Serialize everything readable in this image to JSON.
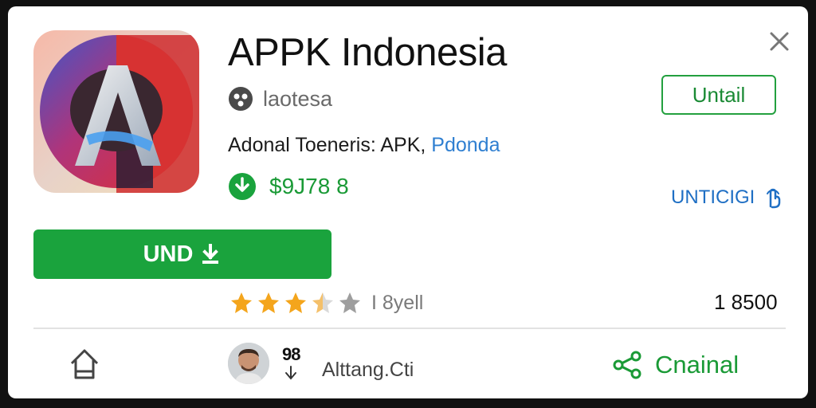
{
  "app": {
    "title": "APPK Indonesia",
    "developer": "laotesa",
    "description_main": "Adonal Toeneris: APK,",
    "description_link": "Pdonda",
    "downloads": "$9J78 8"
  },
  "actions": {
    "outline_button_label": "Untail",
    "side_link_label": "UNTICIGI",
    "install_button_label": "UND"
  },
  "rating": {
    "stars": 3.5,
    "max_stars": 5,
    "label": "I 8yell",
    "count": "1 8500"
  },
  "footer": {
    "user_number": "98",
    "user_name": "Alttang.Cti",
    "share_label": "Cnainal"
  },
  "colors": {
    "accent_green": "#1aa33d",
    "link_blue": "#2f7fd1",
    "star_gold": "#f4a51c",
    "star_grey": "#9e9e9e"
  },
  "icons": {
    "close": "close-icon",
    "developer": "developer-icon",
    "download": "download-icon",
    "side_link": "hand-icon",
    "install": "download-arrow-icon",
    "home": "home-icon",
    "share": "share-icon"
  }
}
